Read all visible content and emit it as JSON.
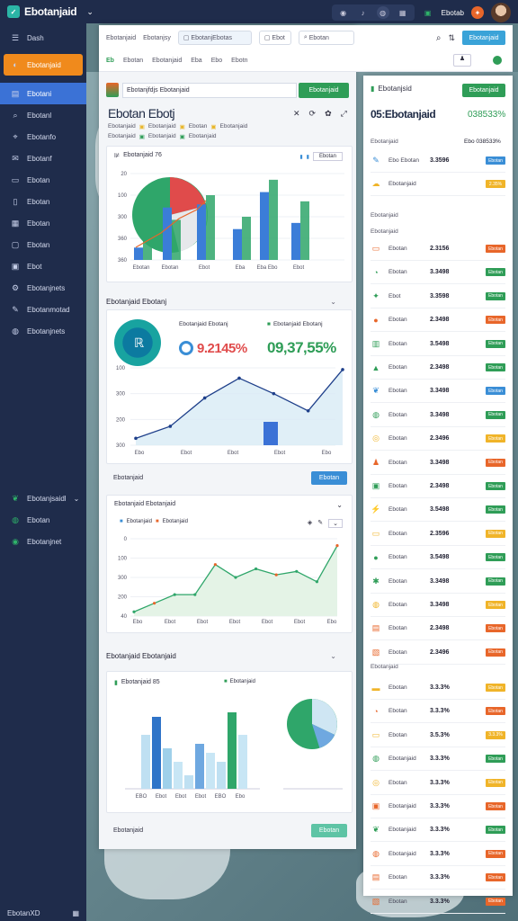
{
  "app": {
    "title": "Ebotanjaid"
  },
  "topbar": {
    "icons": [
      "camera-icon",
      "bell-icon",
      "globe-icon",
      "chart-icon",
      "grid-icon",
      "fire-icon"
    ],
    "user_label": "Ebotab"
  },
  "sidebar": {
    "items": [
      {
        "label": "Dash",
        "icon": "menu-icon"
      },
      {
        "label": "Ebotanjaid",
        "icon": "brand-icon",
        "style": "orange"
      },
      {
        "label": "Ebotani",
        "icon": "list-icon",
        "style": "active"
      },
      {
        "label": "Ebotanl",
        "icon": "search-icon"
      },
      {
        "label": "Ebotanfo",
        "icon": "pin-icon"
      },
      {
        "label": "Ebotanf",
        "icon": "mail-icon"
      },
      {
        "label": "Ebotan",
        "icon": "folder-icon"
      },
      {
        "label": "Ebotan",
        "icon": "doc-icon"
      },
      {
        "label": "Ebotan",
        "icon": "grid-icon"
      },
      {
        "label": "Ebotan",
        "icon": "file-icon"
      },
      {
        "label": "Ebot",
        "icon": "box-icon"
      },
      {
        "label": "Ebotanjnets",
        "icon": "settings-icon"
      },
      {
        "label": "Ebotanmotad",
        "icon": "pen-icon"
      },
      {
        "label": "Ebotanjnets",
        "icon": "globe-icon"
      }
    ],
    "group_items": [
      {
        "label": "Ebotanjsaidl",
        "icon": "leaf-icon"
      },
      {
        "label": "Ebotan",
        "icon": "globe-icon"
      },
      {
        "label": "Ebotanjnet",
        "icon": "earth-icon"
      }
    ],
    "footer": "EbotanXD"
  },
  "toolbar": {
    "field1": "Ebotanjaid",
    "field2": "Ebotanjsy",
    "field3": "EbotanjEbotas",
    "field4": "Ebot",
    "search_placeholder": "Ebotan",
    "action_label": "Ebotanjaid",
    "tabs": [
      "Ebotan",
      "Ebotanjaid",
      "Eba",
      "Ebo",
      "Ebotn"
    ]
  },
  "main": {
    "header_input": "Ebotanjfdjs Ebotanjaid",
    "header_button": "Ebotanjaid",
    "page_title": "Ebotan Ebotj",
    "subtitle_items": [
      "Ebotanjaid",
      "Ebotanjaid",
      "Ebotan",
      "Ebotanjaid"
    ],
    "chart1": {
      "title": "Ebotanjaid 76",
      "legend": "Ebotan",
      "footer_labels": [
        "Ebotan",
        "Ebotan",
        "Ebot",
        "Eba",
        "Eba Ebo",
        "Ebot"
      ]
    },
    "sec2": {
      "title": "Ebotanjaid Ebotanj"
    },
    "stat1": {
      "label": "Ebotanjaid Ebotanj",
      "value": "9.2145%"
    },
    "stat2": {
      "label": "Ebotanjaid Ebotanj",
      "value": "09,37,55%"
    },
    "sec2_footer": "Ebotanjaid",
    "sec2_button": "Ebotan",
    "sec3": {
      "title": "Ebotanjaid Ebotanjaid",
      "legend": [
        "Ebotanjaid",
        "Ebotanjaid"
      ]
    },
    "sec4": {
      "title": "Ebotanjaid Ebotanjaid",
      "legend1": "Ebotanjaid 85",
      "legend2": "Ebotanjaid"
    },
    "sec4_footer": "Ebotanjaid",
    "sec4_button": "Ebotan"
  },
  "chart_data": [
    {
      "type": "bar",
      "title": "Ebotanjaid 76",
      "y_ticks": [
        "360",
        "360",
        "300",
        "100",
        "20"
      ],
      "categories": [
        "Ebotan",
        "Ebotan",
        "Ebot",
        "Eba",
        "Eba Ebo",
        "Ebot"
      ],
      "series": [
        {
          "values": [
            20,
            85,
            90,
            50,
            110,
            60
          ],
          "color": "#3b7dd8"
        },
        {
          "values": [
            35,
            65,
            105,
            70,
            130,
            95
          ],
          "color": "#2fa66a"
        }
      ]
    },
    {
      "type": "area",
      "y_ticks": [
        "300",
        "200",
        "300",
        "100"
      ],
      "x_labels": [
        "Ebo",
        "Ebot",
        "Ebot",
        "Ebot",
        "Ebo"
      ],
      "values": [
        8,
        22,
        55,
        78,
        60,
        40,
        88
      ]
    },
    {
      "type": "area",
      "y_ticks": [
        "40",
        "200",
        "300",
        "100",
        "0"
      ],
      "x_labels": [
        "Ebo",
        "Ebot",
        "Ebot",
        "Ebot",
        "Ebot",
        "Ebot",
        "Ebo"
      ],
      "values": [
        5,
        15,
        25,
        25,
        60,
        45,
        55,
        48,
        52,
        40,
        82
      ]
    },
    {
      "type": "bar",
      "categories": [
        "EBO",
        "Ebot",
        "Ebot",
        "Ebot",
        "EBO",
        "Ebo"
      ],
      "values": [
        60,
        80,
        45,
        30,
        15,
        50,
        40,
        30,
        85,
        60
      ],
      "pie": [
        55,
        30,
        15
      ]
    }
  ],
  "right_panel": {
    "header": "Ebotanjsid",
    "header_button": "Ebotanjaid",
    "big_value": "05:Ebotanjaid",
    "big_value2": "038533%",
    "sub": "Ebotanjaid",
    "sub_val": "Ebo 038533%",
    "section_a": "Ebotanjaid",
    "section_b": "Ebotanjaid",
    "section_c": "Ebotanjaid",
    "rows": [
      {
        "name": "Ebo Ebotan",
        "val": "3.3596",
        "badge": "Ebotan",
        "color": "#3a8ed6",
        "icon": "pen-icon"
      },
      {
        "name": "Ebotanjaid",
        "val": "",
        "badge": "2.35%",
        "color": "#f0b429",
        "icon": "cloud-icon"
      },
      {
        "name": "Ebotan",
        "val": "2.3156",
        "badge": "Ebotan",
        "color": "#e8662a",
        "icon": "device-icon"
      },
      {
        "name": "Ebotan",
        "val": "3.3498",
        "badge": "Ebotan",
        "color": "#2f9d57",
        "icon": "gauge-icon"
      },
      {
        "name": "Ebot",
        "val": "3.3598",
        "badge": "Ebotan",
        "color": "#2f9d57",
        "icon": "spark-icon"
      },
      {
        "name": "Ebotan",
        "val": "2.3498",
        "badge": "Ebotan",
        "color": "#e8662a",
        "icon": "drop-icon"
      },
      {
        "name": "Ebotan",
        "val": "3.5498",
        "badge": "Ebotan",
        "color": "#2f9d57",
        "icon": "building-icon"
      },
      {
        "name": "Ebotan",
        "val": "2.3498",
        "badge": "Ebotan",
        "color": "#2f9d57",
        "icon": "triangle-icon"
      },
      {
        "name": "Ebotan",
        "val": "3.3498",
        "badge": "Ebotan",
        "color": "#3a8ed6",
        "icon": "leaf-icon"
      },
      {
        "name": "Ebotan",
        "val": "3.3498",
        "badge": "Ebotan",
        "color": "#2f9d57",
        "icon": "globe-icon"
      },
      {
        "name": "Ebotan",
        "val": "2.3496",
        "badge": "Ebotan",
        "color": "#f0b429",
        "icon": "camera-icon"
      },
      {
        "name": "Ebotan",
        "val": "3.3498",
        "badge": "Ebotan",
        "color": "#e8662a",
        "icon": "people-icon"
      },
      {
        "name": "Ebotan",
        "val": "2.3498",
        "badge": "Ebotan",
        "color": "#2f9d57",
        "icon": "box-icon"
      },
      {
        "name": "Ebotan",
        "val": "3.5498",
        "badge": "Ebotan",
        "color": "#2f9d57",
        "icon": "bolt-icon"
      },
      {
        "name": "Ebotan",
        "val": "2.3596",
        "badge": "Ebotan",
        "color": "#f0b429",
        "icon": "folder-icon"
      },
      {
        "name": "Ebotan",
        "val": "3.5498",
        "badge": "Ebotan",
        "color": "#2f9d57",
        "icon": "drop-icon"
      },
      {
        "name": "Ebotan",
        "val": "3.3498",
        "badge": "Ebotan",
        "color": "#2f9d57",
        "icon": "bug-icon"
      },
      {
        "name": "Ebotan",
        "val": "3.3498",
        "badge": "Ebotan",
        "color": "#f0b429",
        "icon": "globe-icon"
      },
      {
        "name": "Ebotan",
        "val": "2.3498",
        "badge": "Ebotan",
        "color": "#e8662a",
        "icon": "archive-icon"
      },
      {
        "name": "Ebotan",
        "val": "2.3496",
        "badge": "Ebotan",
        "color": "#e8662a",
        "icon": "image-icon"
      }
    ],
    "rows2": [
      {
        "name": "Ebotan",
        "val": "3.3.3%",
        "badge": "Ebotan",
        "color": "#f0b429",
        "icon": "battery-icon"
      },
      {
        "name": "Ebotan",
        "val": "3.3.3%",
        "badge": "Ebotan",
        "color": "#e8662a",
        "icon": "gauge-icon"
      },
      {
        "name": "Ebotan",
        "val": "3.5.3%",
        "badge": "3.3.3%",
        "color": "#f0b429",
        "icon": "folder-icon"
      },
      {
        "name": "Ebotanjaid",
        "val": "3.3.3%",
        "badge": "Ebotan",
        "color": "#2f9d57",
        "icon": "globe-icon"
      },
      {
        "name": "Ebotan",
        "val": "3.3.3%",
        "badge": "Ebotan",
        "color": "#f0b429",
        "icon": "camera-icon"
      },
      {
        "name": "Ebotanjaid",
        "val": "3.3.3%",
        "badge": "Ebotan",
        "color": "#e8662a",
        "icon": "box-icon"
      },
      {
        "name": "Ebotanjaid",
        "val": "3.3.3%",
        "badge": "Ebotan",
        "color": "#2f9d57",
        "icon": "leaf-icon"
      },
      {
        "name": "Ebotanjaid",
        "val": "3.3.3%",
        "badge": "Ebotan",
        "color": "#e8662a",
        "icon": "globe-icon"
      },
      {
        "name": "Ebotan",
        "val": "3.3.3%",
        "badge": "Ebotan",
        "color": "#e8662a",
        "icon": "archive-icon"
      },
      {
        "name": "Ebotan",
        "val": "3.3.3%",
        "badge": "Ebotan",
        "color": "#e8662a",
        "icon": "image-icon"
      }
    ]
  }
}
